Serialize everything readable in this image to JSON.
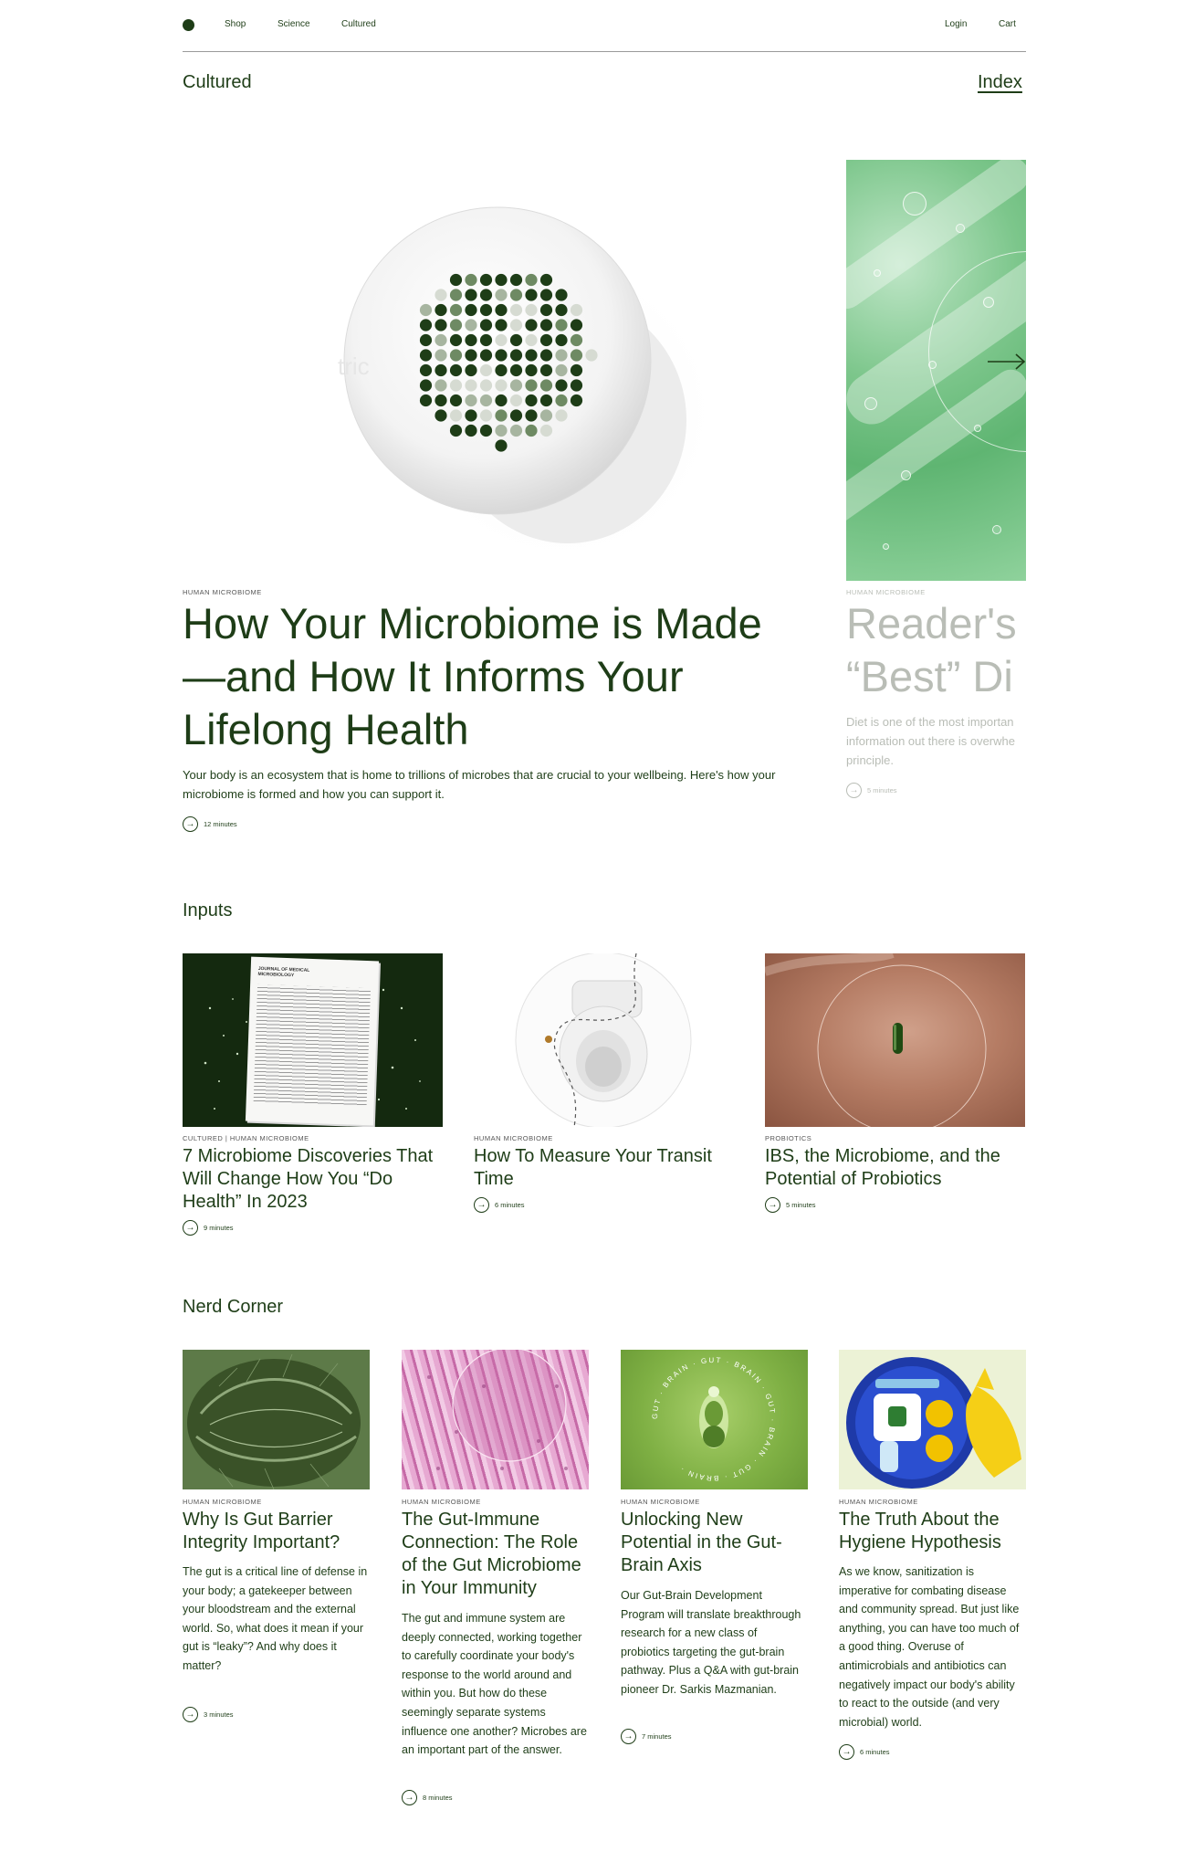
{
  "nav": {
    "links": [
      "Shop",
      "Science",
      "Cultured"
    ],
    "login": "Login",
    "cart": "Cart"
  },
  "header": {
    "title": "Cultured",
    "index": "Index"
  },
  "hero": {
    "eyebrow": "HUMAN MICROBIOME",
    "title": "How Your Microbiome is Made —and How It Informs Your Lifelong Health",
    "desc": "Your body is an ecosystem that is home to trillions of microbes that are crucial to your wellbeing. Here's how your microbiome is formed and how you can support it.",
    "time": "12 minutes",
    "art_fragment": "tric"
  },
  "hero_side": {
    "eyebrow": "HUMAN MICROBIOME",
    "title_l1": "Reader's",
    "title_l2": "“Best” Di",
    "desc_l1": "Diet is one of the most importan",
    "desc_l2": "information out there is overwhe",
    "desc_l3": "principle.",
    "time": "5 minutes"
  },
  "inputs": {
    "title": "Inputs",
    "items": [
      {
        "eyebrow": "CULTURED | HUMAN MICROBIOME",
        "title": "7 Microbiome Discoveries That Will Change How You “Do Health” In 2023",
        "time": "9 minutes",
        "paper_journal": "JOURNAL OF MEDICAL MICROBIOLOGY"
      },
      {
        "eyebrow": "HUMAN MICROBIOME",
        "title": "How To Measure Your Transit Time",
        "time": "6 minutes"
      },
      {
        "eyebrow": "PROBIOTICS",
        "title": "IBS, the Microbiome, and the Potential of Probiotics",
        "time": "5 minutes"
      }
    ]
  },
  "nerd": {
    "title": "Nerd Corner",
    "items": [
      {
        "eyebrow": "HUMAN MICROBIOME",
        "title": "Why Is Gut Barrier Integrity Important?",
        "desc": "The gut is a critical line of defense in your body; a gatekeeper between your bloodstream and the external world. So, what does it mean if your gut is “leaky”? And why does it matter?",
        "time": "3 minutes"
      },
      {
        "eyebrow": "HUMAN MICROBIOME",
        "title": "The Gut-Immune Connection: The Role of the Gut Microbiome in Your Immunity",
        "desc": "The gut and immune system are deeply connected, working together to carefully coordinate your body's response to the world around and within you. But how do these seemingly separate systems influence one another? Microbes are an important part of the answer.",
        "time": "8 minutes"
      },
      {
        "eyebrow": "HUMAN MICROBIOME",
        "title": "Unlocking New Potential in the Gut-Brain Axis",
        "desc": "Our Gut-Brain Development Program will translate breakthrough research for a new class of probiotics targeting the gut-brain pathway. Plus a Q&A with gut-brain pioneer Dr. Sarkis Mazmanian.",
        "time": "7 minutes",
        "ring_text": "GUT · BRAIN · GUT · BRAIN · GUT · BRAIN · GUT · BRAIN ·"
      },
      {
        "eyebrow": "HUMAN MICROBIOME",
        "title": "The Truth About the Hygiene Hypothesis",
        "desc": "As we know, sanitization is imperative for combating disease and community spread. But just like anything, you can have too much of a good thing. Overuse of antimicrobials and antibiotics can negatively impact our body's ability to react to the outside (and very microbial) world.",
        "time": "6 minutes"
      }
    ]
  }
}
